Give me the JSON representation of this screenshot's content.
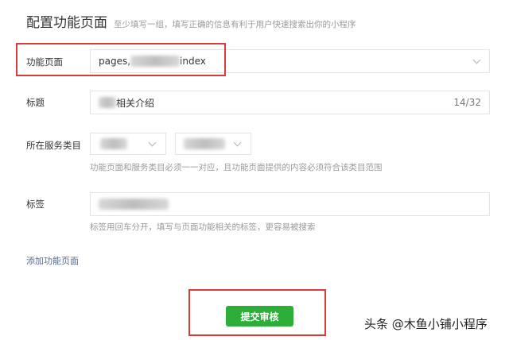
{
  "header": {
    "title": "配置功能页面",
    "hint": "至少填写一组，填写正确的信息有利于用户快速搜索出你的小程序"
  },
  "page_field": {
    "label": "功能页面",
    "value_prefix": "pages,",
    "value_suffix": "index",
    "dropdown_icon": "chevron-down-icon"
  },
  "title_field": {
    "label": "标题",
    "value_visible": "相关介绍",
    "counter": "14/32"
  },
  "category_field": {
    "label": "所在服务类目",
    "hint": "功能页面和服务类目必须一一对应，且功能页面提供的内容必须符合该类目范围"
  },
  "tags_field": {
    "label": "标签",
    "hint": "标签用回车分开，填写与页面功能相关的标签，更容易被搜索"
  },
  "add_link": "添加功能页面",
  "submit_label": "提交审核",
  "watermark": "头条 @木鱼小铺小程序",
  "colors": {
    "highlight": "#d93b3b",
    "primary": "#2dae39",
    "link": "#576b95"
  }
}
